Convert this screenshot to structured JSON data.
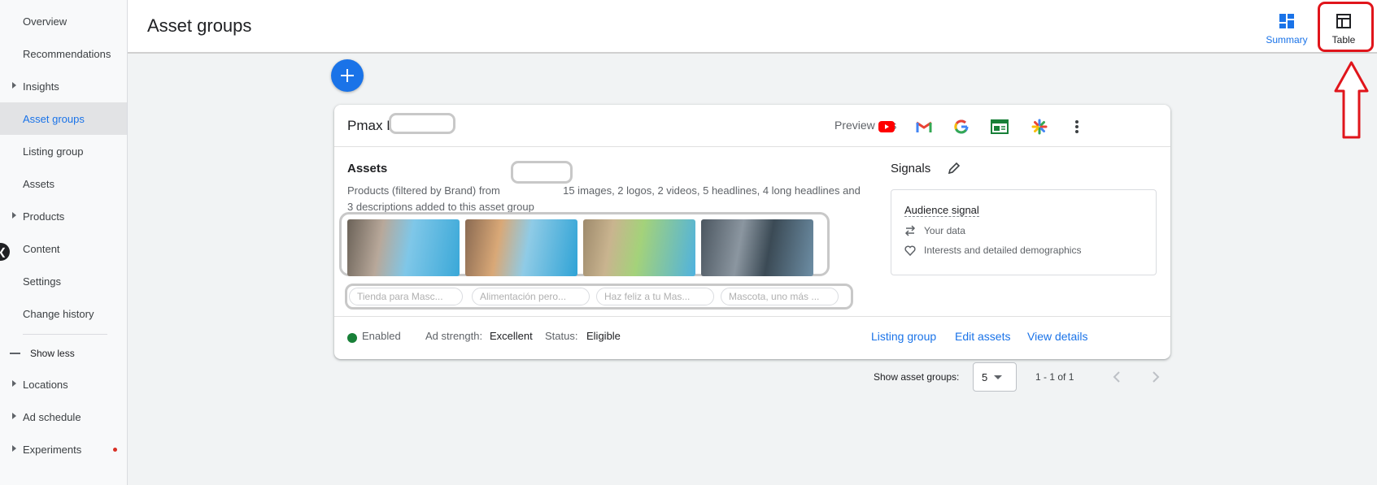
{
  "sidebar": {
    "items": [
      {
        "label": "Overview"
      },
      {
        "label": "Recommendations"
      },
      {
        "label": "Insights"
      },
      {
        "label": "Asset groups"
      },
      {
        "label": "Listing group"
      },
      {
        "label": "Assets"
      },
      {
        "label": "Products"
      },
      {
        "label": "Content"
      },
      {
        "label": "Settings"
      },
      {
        "label": "Change history"
      }
    ],
    "show_less": "Show less",
    "extra_items": [
      {
        "label": "Locations"
      },
      {
        "label": "Ad schedule"
      },
      {
        "label": "Experiments"
      }
    ]
  },
  "header": {
    "title": "Asset groups",
    "views": {
      "summary": "Summary",
      "table": "Table"
    }
  },
  "card": {
    "group_name": "Pmax I",
    "preview_label": "Preview ads",
    "icons": [
      "youtube-icon",
      "gmail-icon",
      "google-icon",
      "display-icon",
      "discover-icon",
      "more-vert-icon"
    ],
    "assets_title": "Assets",
    "assets_desc_1": "Products (filtered by Brand) from",
    "assets_desc_2": "15 images, 2 logos, 2 videos, 5 headlines, 4 long headlines and 3 descriptions added to this asset group",
    "chips": [
      "Tienda para Masc...",
      "Alimentación pero...",
      "Haz feliz a tu Mas...",
      "Mascota, uno más ..."
    ],
    "signals_title": "Signals",
    "audience_signal": "Audience signal",
    "your_data": "Your data",
    "interests": "Interests and detailed demographics",
    "status": "Enabled",
    "ad_strength_label": "Ad strength:",
    "ad_strength_value": "Excellent",
    "status_label": "Status:",
    "status_value": "Eligible",
    "links": {
      "listing_group": "Listing group",
      "edit_assets": "Edit assets",
      "view_details": "View details"
    }
  },
  "pagination": {
    "label": "Show asset groups:",
    "selected": "5",
    "range": "1 - 1 of 1"
  },
  "colors": {
    "accent": "#1a73e8",
    "highlight": "#e0151b",
    "enabled": "#188038"
  }
}
